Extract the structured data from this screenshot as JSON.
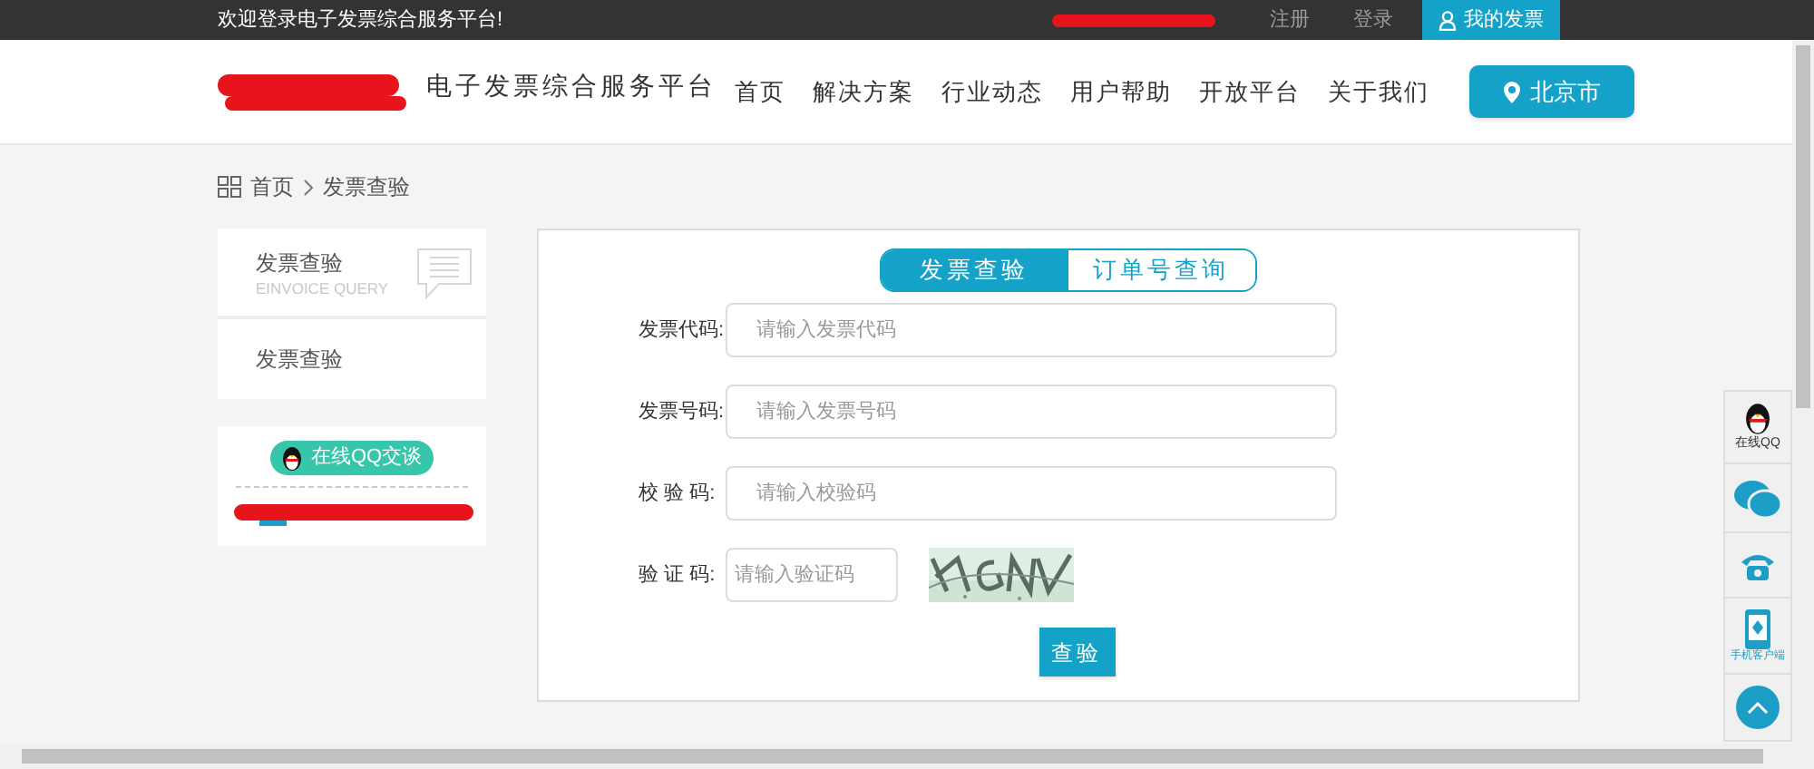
{
  "top_bar": {
    "welcome": "欢迎登录电子发票综合服务平台!",
    "links": [
      {
        "label": "注册"
      },
      {
        "label": "登录"
      }
    ],
    "my_invoice": "我的发票"
  },
  "header": {
    "site_title": "电子发票综合服务平台",
    "nav": [
      {
        "label": "首页"
      },
      {
        "label": "解决方案"
      },
      {
        "label": "行业动态"
      },
      {
        "label": "用户帮助"
      },
      {
        "label": "开放平台"
      },
      {
        "label": "关于我们"
      }
    ],
    "city": "北京市"
  },
  "breadcrumb": [
    {
      "label": "首页"
    },
    {
      "label": "发票查验"
    }
  ],
  "sidebar": {
    "title": "发票查验",
    "subtitle": "EINVOICE QUERY",
    "items": [
      {
        "label": "发票查验"
      }
    ],
    "qq_button": "在线QQ交谈"
  },
  "tabs": [
    {
      "label": "发票查验",
      "selected": true
    },
    {
      "label": "订单号查询",
      "selected": false
    }
  ],
  "form": {
    "fields": [
      {
        "label": "发票代码:",
        "placeholder": "请输入发票代码",
        "kind": "wide"
      },
      {
        "label": "发票号码:",
        "placeholder": "请输入发票号码",
        "kind": "wide"
      },
      {
        "label": "校 验 码:",
        "placeholder": "请输入校验码",
        "kind": "wide"
      },
      {
        "label": "验 证 码:",
        "placeholder": "请输入验证码",
        "kind": "captcha"
      }
    ],
    "submit": "查验"
  },
  "float_bar": {
    "qq_label": "在线QQ",
    "app_label": "手机客户端"
  }
}
